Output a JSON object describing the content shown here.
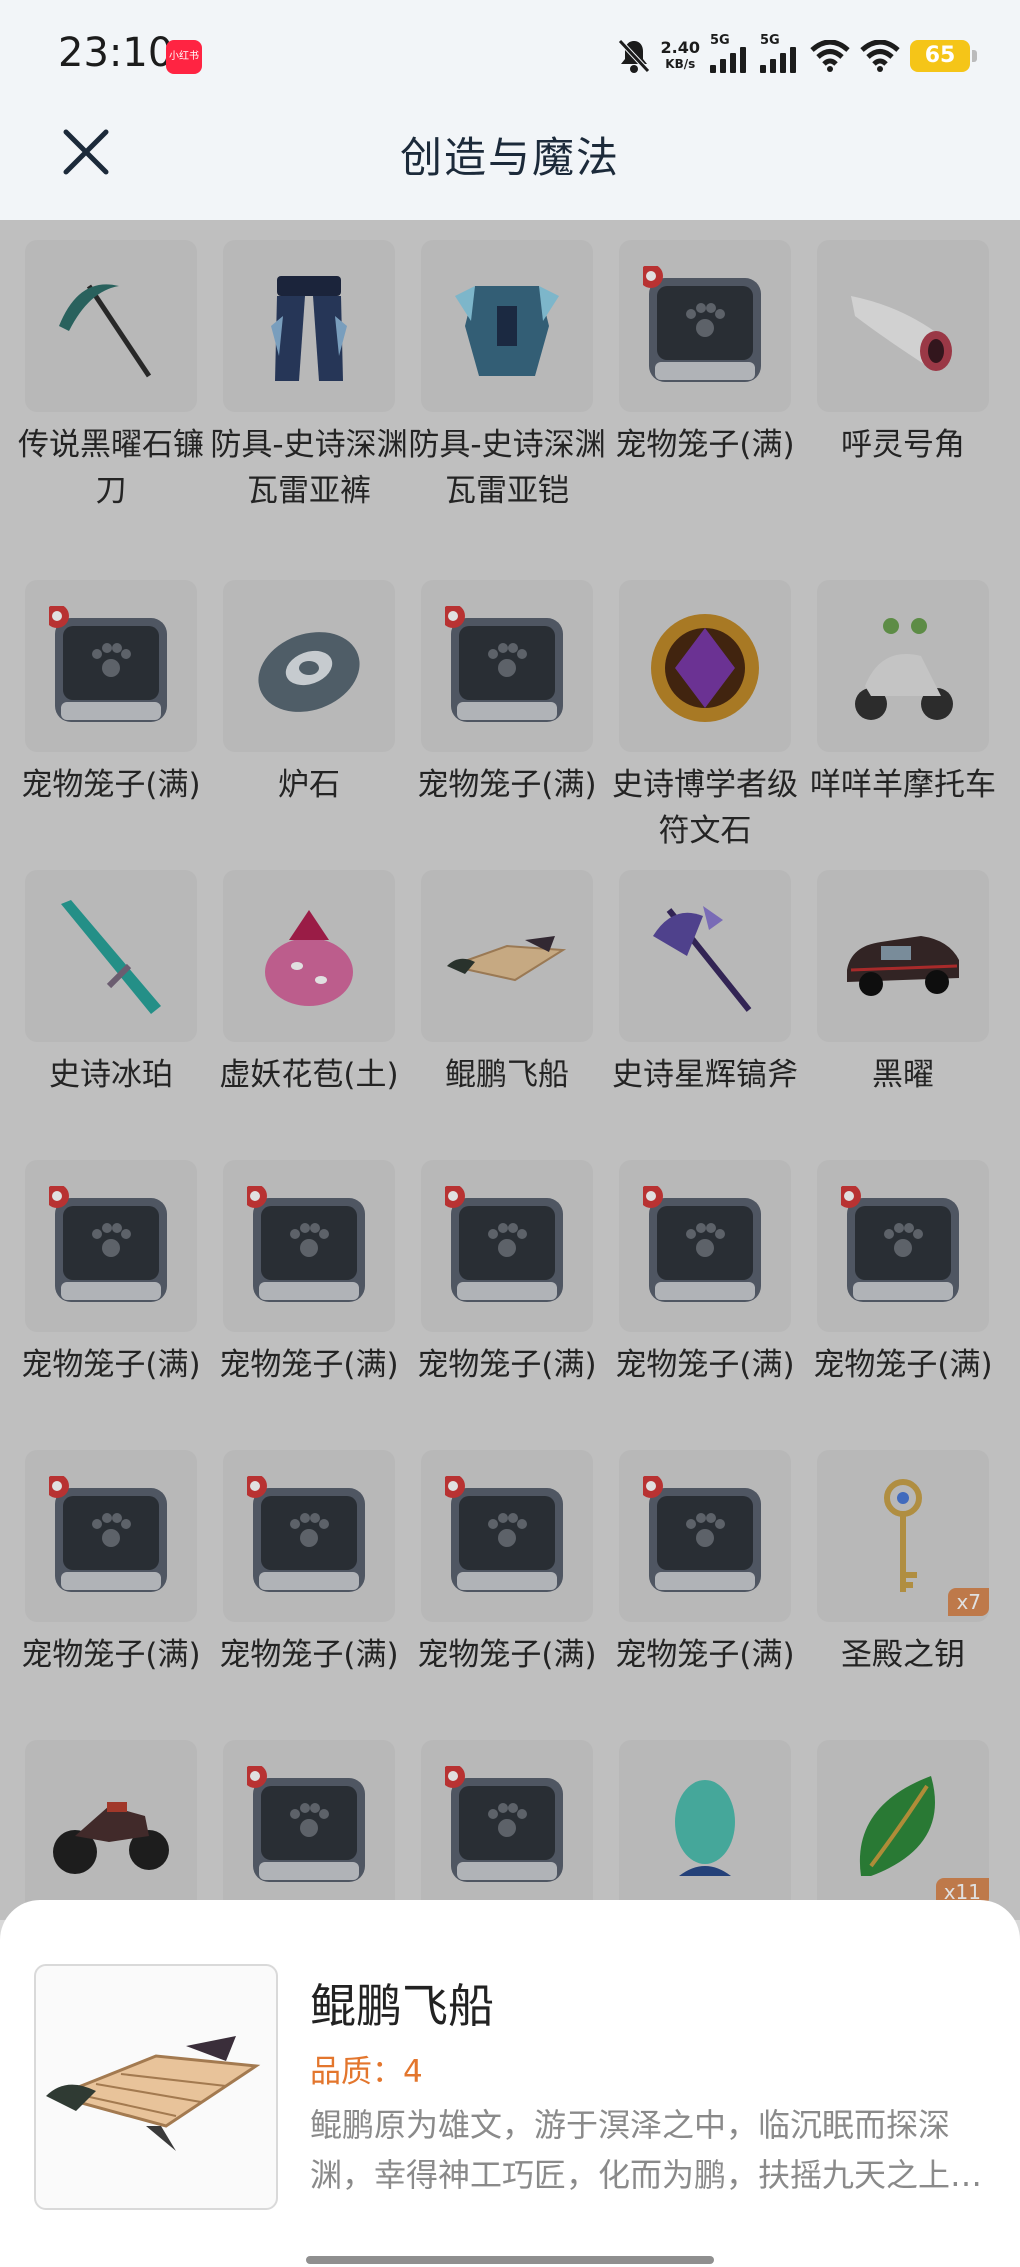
{
  "status": {
    "time": "23:10",
    "app_badge": "小红书",
    "speed_value": "2.40",
    "speed_unit": "KB/s",
    "net1": "5G",
    "net2": "5G",
    "battery": "65"
  },
  "header": {
    "title": "创造与魔法"
  },
  "items": [
    {
      "label": "传说黑曜石镰刀",
      "icon": "scythe-icon",
      "color": "#2f6f6a"
    },
    {
      "label": "防具-史诗深渊瓦雷亚裤",
      "icon": "armor-pants-icon",
      "color": "#2c3e63"
    },
    {
      "label": "防具-史诗深渊瓦雷亚铠",
      "icon": "armor-chest-icon",
      "color": "#3b6b86"
    },
    {
      "label": "宠物笼子(满)",
      "icon": "pet-cage-icon"
    },
    {
      "label": "呼灵号角",
      "icon": "horn-icon",
      "color": "#b04050"
    },
    {
      "label": "宠物笼子(满)",
      "icon": "pet-cage-icon"
    },
    {
      "label": "炉石",
      "icon": "hearthstone-icon",
      "color": "#5a6a76"
    },
    {
      "label": "宠物笼子(满)",
      "icon": "pet-cage-icon"
    },
    {
      "label": "史诗博学者级符文石",
      "icon": "rune-stone-icon",
      "color": "#7a3aa8"
    },
    {
      "label": "咩咩羊摩托车",
      "icon": "scooter-icon",
      "color": "#e0e0e0"
    },
    {
      "label": "史诗冰珀",
      "icon": "ice-sword-icon",
      "color": "#2aa39a"
    },
    {
      "label": "虚妖花苞(土)",
      "icon": "flower-bud-icon",
      "color": "#d66aa0"
    },
    {
      "label": "鲲鹏飞船",
      "icon": "airship-icon",
      "color": "#b08a60"
    },
    {
      "label": "史诗星辉镐斧",
      "icon": "axe-icon",
      "color": "#5b4aa0"
    },
    {
      "label": "黑曜",
      "icon": "car-icon",
      "color": "#3a2a2a"
    },
    {
      "label": "宠物笼子(满)",
      "icon": "pet-cage-icon"
    },
    {
      "label": "宠物笼子(满)",
      "icon": "pet-cage-icon"
    },
    {
      "label": "宠物笼子(满)",
      "icon": "pet-cage-icon"
    },
    {
      "label": "宠物笼子(满)",
      "icon": "pet-cage-icon"
    },
    {
      "label": "宠物笼子(满)",
      "icon": "pet-cage-icon"
    },
    {
      "label": "宠物笼子(满)",
      "icon": "pet-cage-icon"
    },
    {
      "label": "宠物笼子(满)",
      "icon": "pet-cage-icon"
    },
    {
      "label": "宠物笼子(满)",
      "icon": "pet-cage-icon"
    },
    {
      "label": "宠物笼子(满)",
      "icon": "pet-cage-icon"
    },
    {
      "label": "圣殿之钥",
      "icon": "key-icon",
      "color": "#c9a24a",
      "qty": "x7"
    },
    {
      "label": "",
      "icon": "motorbike-icon",
      "color": "#4a3030"
    },
    {
      "label": "",
      "icon": "pet-cage-icon"
    },
    {
      "label": "",
      "icon": "pet-cage-icon"
    },
    {
      "label": "",
      "icon": "egg-icon",
      "color": "#4fbfb0"
    },
    {
      "label": "",
      "icon": "leaf-icon",
      "color": "#2f8a3c",
      "qty": "x11"
    }
  ],
  "detail": {
    "name": "鲲鹏飞船",
    "quality": "品质：4",
    "description": "鲲鹏原为雄文，游于溟泽之中，临沉眠而探深渊，幸得神工巧匠，化而为鹏，扶摇九天之上，乘风破浪，翱翔天际。"
  }
}
